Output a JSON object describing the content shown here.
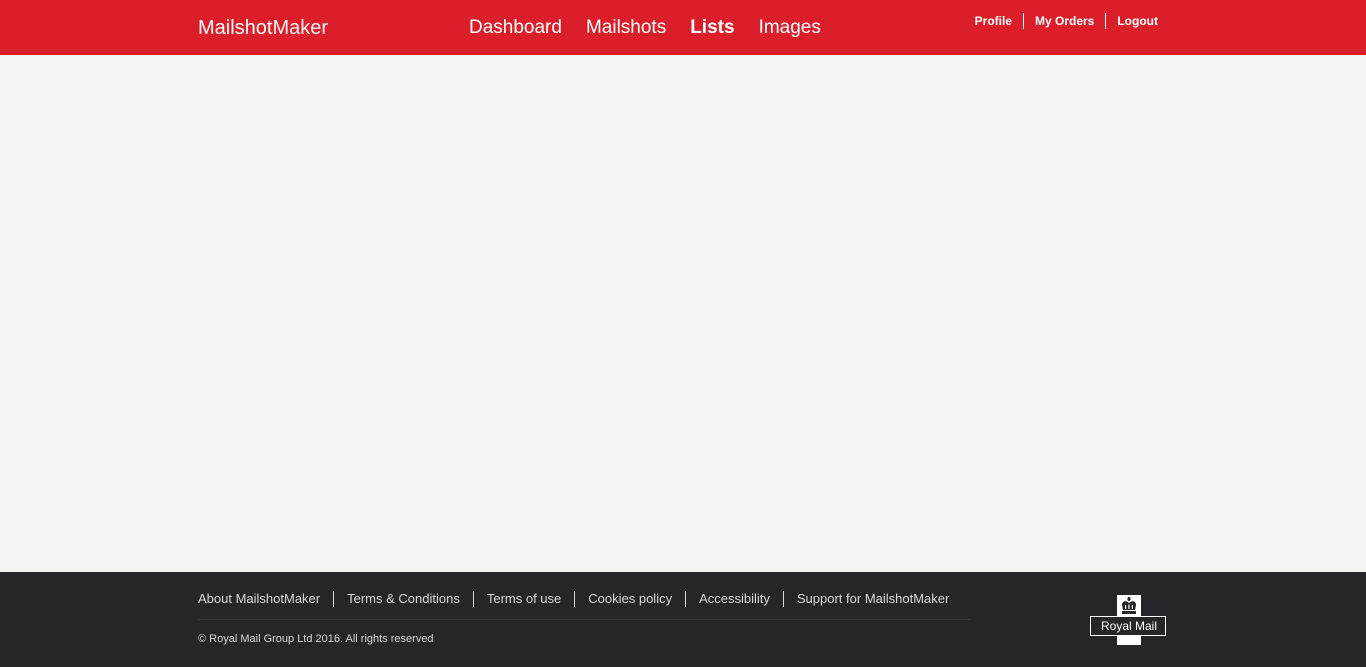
{
  "header": {
    "brand_part1": "Mailshot",
    "brand_part2": "Maker",
    "nav": [
      {
        "label": "Dashboard"
      },
      {
        "label": "Mailshots"
      },
      {
        "label": "Lists"
      },
      {
        "label": "Images"
      }
    ],
    "user_nav": {
      "profile": "Profile",
      "orders": "My Orders",
      "logout": "Logout"
    }
  },
  "footer": {
    "links": [
      {
        "label": "About MailshotMaker"
      },
      {
        "label": "Terms & Conditions"
      },
      {
        "label": "Terms of use"
      },
      {
        "label": "Cookies policy"
      },
      {
        "label": "Accessibility"
      },
      {
        "label": "Support for MailshotMaker"
      }
    ],
    "copyright": "© Royal Mail Group Ltd 2016. All rights reserved",
    "logo_text": "Royal Mail"
  },
  "colors": {
    "brand_red": "#da1f2b",
    "footer_bg": "#26252a",
    "page_bg": "#f4f4f2"
  },
  "icons": {
    "logo": "royal-mail-crown-logo"
  }
}
